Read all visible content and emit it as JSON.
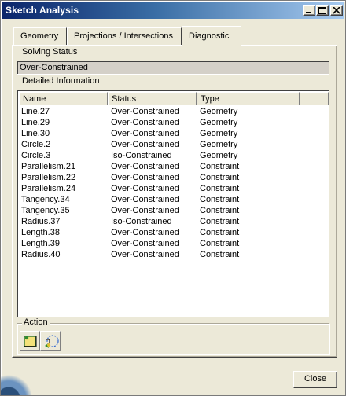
{
  "window": {
    "title": "Sketch Analysis",
    "title_bar_color": "#0a246a",
    "buttons": {
      "minimize": "minimize",
      "maximize": "maximize",
      "close": "close"
    }
  },
  "tabs": [
    {
      "label": "Geometry",
      "active": false
    },
    {
      "label": "Projections / Intersections",
      "active": false
    },
    {
      "label": "Diagnostic",
      "active": true
    }
  ],
  "solving_status": {
    "group_label": "Solving Status",
    "value": "Over-Constrained"
  },
  "detailed_information": {
    "group_label": "Detailed Information",
    "columns": [
      "Name",
      "Status",
      "Type"
    ],
    "rows": [
      [
        "Line.27",
        "Over-Constrained",
        "Geometry"
      ],
      [
        "Line.29",
        "Over-Constrained",
        "Geometry"
      ],
      [
        "Line.30",
        "Over-Constrained",
        "Geometry"
      ],
      [
        "Circle.2",
        "Over-Constrained",
        "Geometry"
      ],
      [
        "Circle.3",
        "Iso-Constrained",
        "Geometry"
      ],
      [
        "Parallelism.21",
        "Over-Constrained",
        "Constraint"
      ],
      [
        "Parallelism.22",
        "Over-Constrained",
        "Constraint"
      ],
      [
        "Parallelism.24",
        "Over-Constrained",
        "Constraint"
      ],
      [
        "Tangency.34",
        "Over-Constrained",
        "Constraint"
      ],
      [
        "Tangency.35",
        "Over-Constrained",
        "Constraint"
      ],
      [
        "Radius.37",
        "Iso-Constrained",
        "Constraint"
      ],
      [
        "Length.38",
        "Over-Constrained",
        "Constraint"
      ],
      [
        "Length.39",
        "Over-Constrained",
        "Constraint"
      ],
      [
        "Radius.40",
        "Over-Constrained",
        "Constraint"
      ]
    ]
  },
  "action": {
    "group_label": "Action",
    "icons": [
      "hide-geometry-icon",
      "show-constraint-icon"
    ]
  },
  "footer": {
    "close_label": "Close"
  }
}
